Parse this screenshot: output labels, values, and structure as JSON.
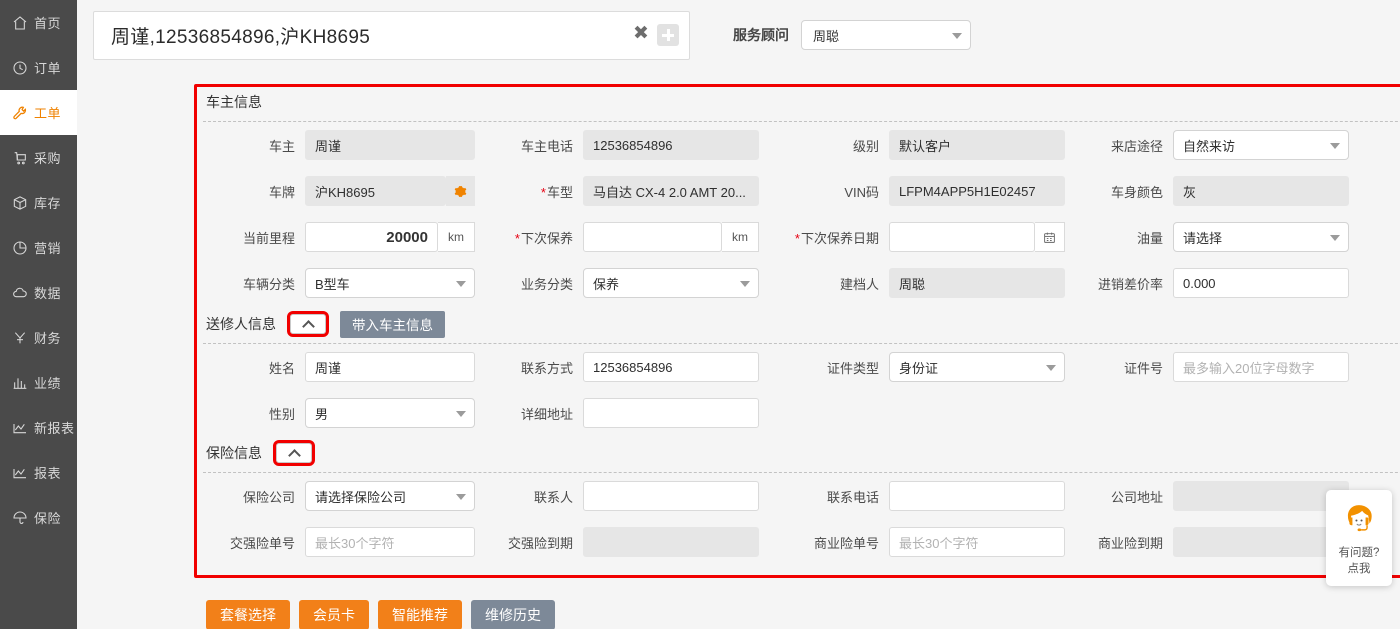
{
  "sidebar": {
    "items": [
      {
        "label": "首页",
        "icon": "home-icon",
        "active": false
      },
      {
        "label": "订单",
        "icon": "clock-icon",
        "active": false
      },
      {
        "label": "工单",
        "icon": "wrench-icon",
        "active": true
      },
      {
        "label": "采购",
        "icon": "cart-icon",
        "active": false
      },
      {
        "label": "库存",
        "icon": "box-icon",
        "active": false
      },
      {
        "label": "营销",
        "icon": "pie-chart-icon",
        "active": false
      },
      {
        "label": "数据",
        "icon": "cloud-icon",
        "active": false
      },
      {
        "label": "财务",
        "icon": "yen-icon",
        "active": false
      },
      {
        "label": "业绩",
        "icon": "bar-chart-icon",
        "active": false
      },
      {
        "label": "新报表",
        "icon": "line-chart-icon",
        "active": false
      },
      {
        "label": "报表",
        "icon": "line-chart-icon",
        "active": false
      },
      {
        "label": "保险",
        "icon": "umbrella-icon",
        "active": false
      }
    ]
  },
  "topbar": {
    "search_value": "周谨,12536854896,沪KH8695",
    "clear_icon": "close-icon",
    "add_icon": "plus-icon",
    "adviser_label": "服务顾问",
    "adviser_value": "周聪"
  },
  "sections": {
    "owner": {
      "title": "车主信息",
      "fields": {
        "owner_name_label": "车主",
        "owner_name_value": "周谨",
        "owner_phone_label": "车主电话",
        "owner_phone_value": "12536854896",
        "level_label": "级别",
        "level_value": "默认客户",
        "visit_channel_label": "来店途径",
        "visit_channel_value": "自然来访",
        "plate_label": "车牌",
        "plate_value": "沪KH8695",
        "plate_gear_icon": "gear-icon",
        "model_label": "车型",
        "model_value": "马自达 CX-4 2.0 AMT 20...",
        "vin_label": "VIN码",
        "vin_value": "LFPM4APP5H1E02457",
        "body_color_label": "车身颜色",
        "body_color_value": "灰",
        "mileage_label": "当前里程",
        "mileage_value": "20000",
        "mileage_unit": "km",
        "next_service_label": "下次保养",
        "next_service_value": "",
        "next_service_unit": "km",
        "next_service_date_label": "下次保养日期",
        "next_service_date_value": "",
        "next_service_date_icon": "calendar-icon",
        "fuel_label": "油量",
        "fuel_value": "请选择",
        "vehicle_class_label": "车辆分类",
        "vehicle_class_value": "B型车",
        "business_class_label": "业务分类",
        "business_class_value": "保养",
        "creator_label": "建档人",
        "creator_value": "周聪",
        "margin_label": "进销差价率",
        "margin_value": "0.000"
      }
    },
    "sender": {
      "title": "送修人信息",
      "collapse_icon": "chevron-up-icon",
      "copy_button": "带入车主信息",
      "fields": {
        "name_label": "姓名",
        "name_value": "周谨",
        "contact_label": "联系方式",
        "contact_value": "12536854896",
        "id_type_label": "证件类型",
        "id_type_value": "身份证",
        "id_no_label": "证件号",
        "id_no_placeholder": "最多输入20位字母数字",
        "gender_label": "性别",
        "gender_value": "男",
        "address_label": "详细地址",
        "address_value": ""
      }
    },
    "insurance": {
      "title": "保险信息",
      "collapse_icon": "chevron-up-icon",
      "fields": {
        "company_label": "保险公司",
        "company_value": "请选择保险公司",
        "contact_person_label": "联系人",
        "contact_person_value": "",
        "contact_phone_label": "联系电话",
        "contact_phone_value": "",
        "company_address_label": "公司地址",
        "company_address_value": "",
        "ctp_no_label": "交强险单号",
        "ctp_no_placeholder": "最长30个字符",
        "ctp_exp_label": "交强险到期",
        "ctp_exp_value": "",
        "comm_no_label": "商业险单号",
        "comm_no_placeholder": "最长30个字符",
        "comm_exp_label": "商业险到期",
        "comm_exp_value": ""
      }
    }
  },
  "actions": [
    {
      "label": "套餐选择",
      "style": "orange"
    },
    {
      "label": "会员卡",
      "style": "orange"
    },
    {
      "label": "智能推荐",
      "style": "orange"
    },
    {
      "label": "维修历史",
      "style": "grey"
    }
  ],
  "chat": {
    "icon": "headset-agent-icon",
    "line1": "有问题?",
    "line2": "点我"
  },
  "colors": {
    "accent_orange": "#ef8200",
    "highlight_red": "#f10000",
    "sidebar_bg": "#4a4a4a",
    "grey_button": "#7d8998"
  }
}
